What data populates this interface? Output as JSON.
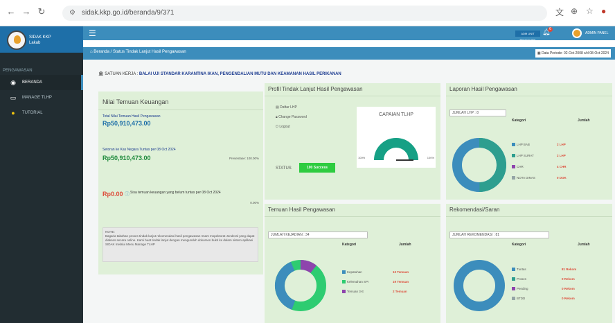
{
  "browser": {
    "url": "sidak.kkp.go.id/beranda/9/371"
  },
  "app": {
    "brand_line1": "SIDAK KKP",
    "brand_line2": "Lakab",
    "sidebar_header": "PENGAWASAN",
    "menu": [
      {
        "label": "BERANDA",
        "icon": "dashboard-icon"
      },
      {
        "label": "MANAGE TLHP",
        "icon": "monitor-icon"
      },
      {
        "label": "TUTORIAL",
        "icon": "help-icon"
      }
    ],
    "top_badge": "ADM UNIT PENGGUNA",
    "notif_count": "6",
    "user_name": "ADMIN PANEL",
    "breadcrumb": "Beranda   /   Status Tindak Lanjut Hasil Pengawasan",
    "period": "Data Periode: 02-Oct-2008 s/d 08-Oct-2024"
  },
  "satuan": {
    "label": "SATUAN KERJA :",
    "value": "BALAI UJI STANDAR KARANTINA IKAN, PENGENDALIAN MUTU DAN KEAMANAN HASIL PERIKANAN"
  },
  "keuangan": {
    "title": "Nilai Temuan Keuangan",
    "total_label": "Total Nilai Temuan Hasil Pengawasan",
    "total_value": "Rp50,910,473.00",
    "setoran_label": "Setoran ke Kas Negara Tuntas per 08 Oct 2024",
    "setoran_value": "Rp50,910,473.00",
    "persentase": "Presentase: 100.00%",
    "sisa_value": "Rp0.00",
    "sisa_label": "Sisa temuan keuangan yang belum tuntas per 08 Oct 2024",
    "sisa_pct": "0.00%",
    "note_title": "NOTE:",
    "note_text": "Bagaria tabahan proses tindak lanjut rekomendasi hasil pengawasan Imam Inspektorat Jenderal yang dapat diakses secara online. Kami buat tindak lanjut dengan mengunduh dokumen bukti ke dalam sistem aplikasi SIDAK melalui Menu Manage TLHP"
  },
  "profil": {
    "title": "Profil Tindak Lanjut Hasil Pengawasan",
    "items": [
      "Daftar LHP",
      "Change Password",
      "Logout"
    ],
    "gauge_title": "CAPAIAN TLHP",
    "gauge_min": "100%",
    "gauge_max": "100%",
    "status_label": "STATUS",
    "status_value": "100 Success"
  },
  "laporan": {
    "title": "Laporan Hasil Pengawasan",
    "count_label": "JUMLAH LHP : 8",
    "col_kategori": "Kategori",
    "col_jumlah": "Jumlah",
    "rows": [
      {
        "label": "LHP BAB",
        "value": "2 LHP",
        "color": "#3c8dbc"
      },
      {
        "label": "LHP SURAT",
        "value": "2 LHP",
        "color": "#2e9e8f"
      },
      {
        "label": "CHR",
        "value": "4 CHR",
        "color": "#8e44ad"
      },
      {
        "label": "NOTA DINAS",
        "value": "0 DOK",
        "color": "#95a5a6"
      }
    ]
  },
  "temuan": {
    "title": "Temuan Hasil Pengawasan",
    "count_label": "JUMLAH KEJADIAN : 34",
    "col_kategori": "Kategori",
    "col_jumlah": "Jumlah",
    "rows": [
      {
        "label": "Kepatuhan",
        "value": "13 Temuan",
        "color": "#3c8dbc"
      },
      {
        "label": "Kelemahan SPI",
        "value": "19 Temuan",
        "color": "#2ecc71"
      },
      {
        "label": "Temuan 3-E",
        "value": "2 Temuan",
        "color": "#8e44ad"
      }
    ]
  },
  "rekomendasi": {
    "title": "Rekomendasi/Saran",
    "count_label": "JUMLAH REKOMENDASI : 81",
    "col_kategori": "Kategori",
    "col_jumlah": "Jumlah",
    "rows": [
      {
        "label": "Tuntas",
        "value": "81 Rekom",
        "color": "#3c8dbc"
      },
      {
        "label": "Proses",
        "value": "0 Rekom",
        "color": "#2e9e8f"
      },
      {
        "label": "Pending",
        "value": "0 Rekom",
        "color": "#8e44ad"
      },
      {
        "label": "BTDD",
        "value": "0 Rekom",
        "color": "#95a5a6"
      }
    ]
  }
}
